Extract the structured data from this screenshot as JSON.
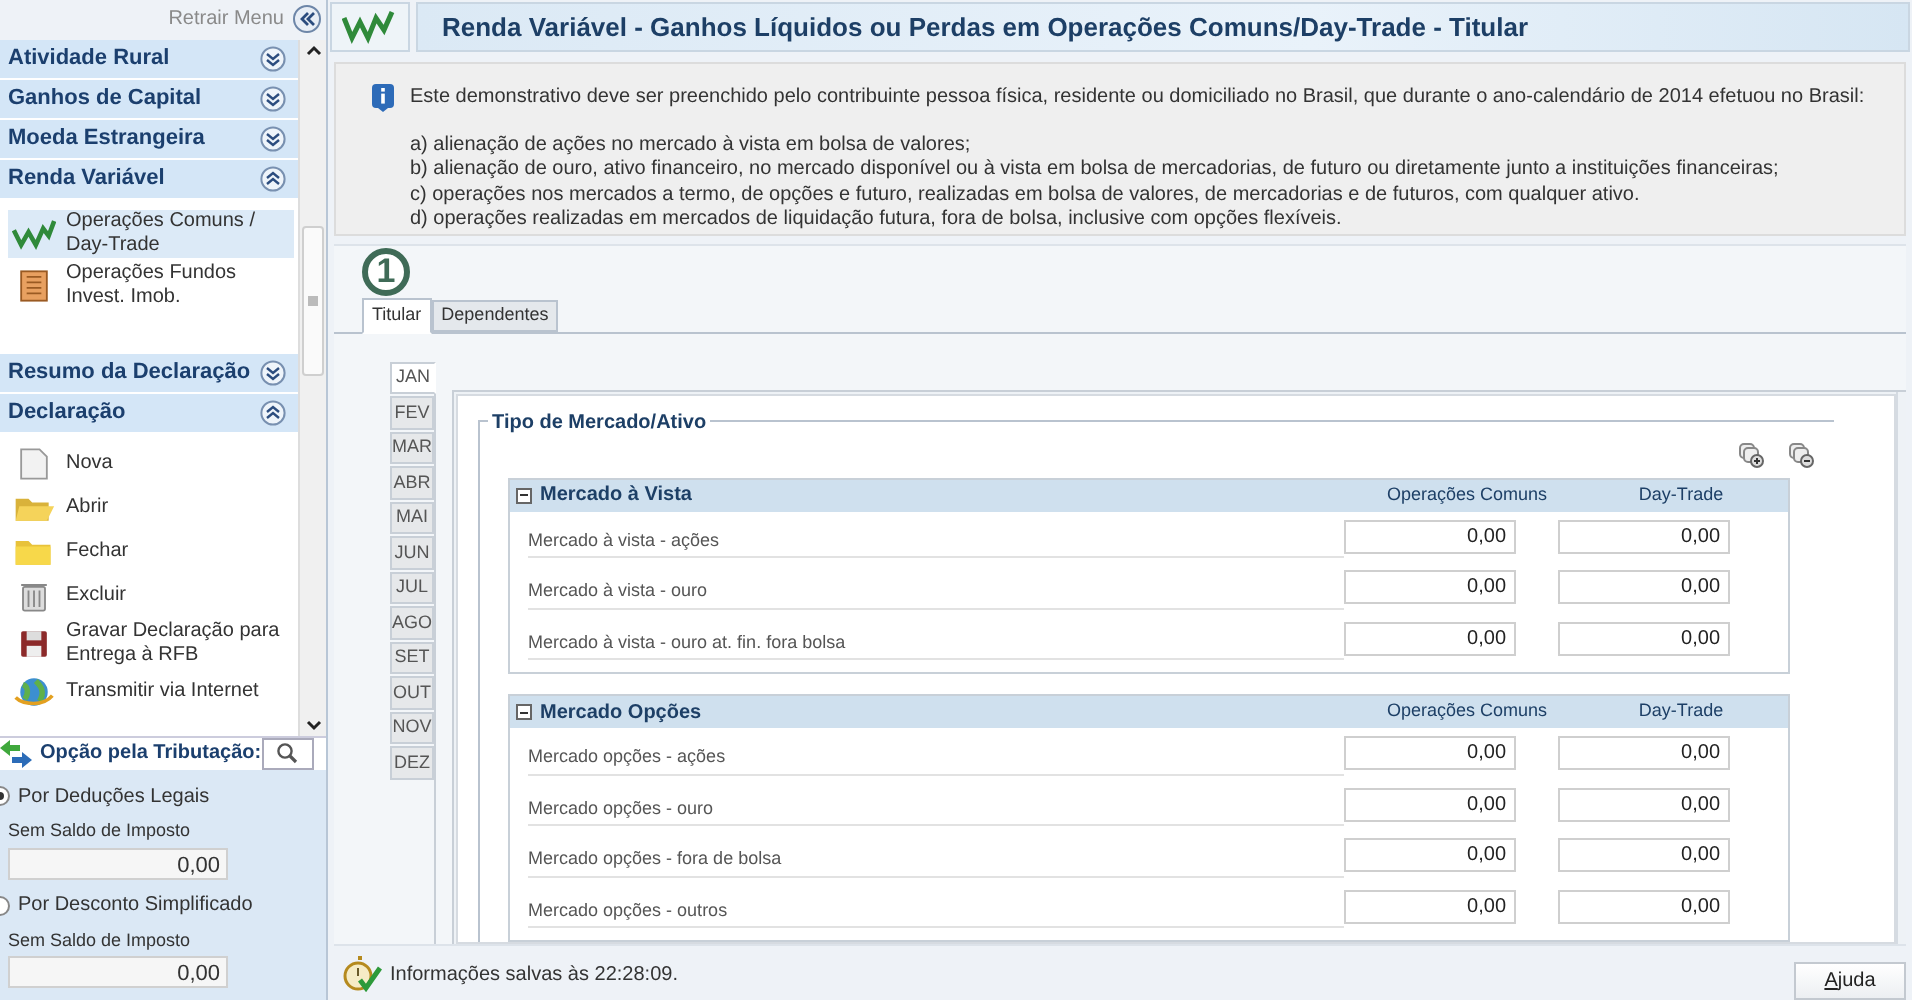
{
  "sidebar": {
    "collapse_label": "Retrair Menu",
    "sections": [
      {
        "title": "Atividade Rural",
        "expanded": false
      },
      {
        "title": "Ganhos de Capital",
        "expanded": false
      },
      {
        "title": "Moeda Estrangeira",
        "expanded": false
      },
      {
        "title": "Renda Variável",
        "expanded": true,
        "items": [
          {
            "label": "Operações Comuns / Day-Trade",
            "selected": true
          },
          {
            "label": "Operações Fundos Invest. Imob.",
            "selected": false
          }
        ]
      },
      {
        "title": "Resumo da Declaração",
        "expanded": false
      },
      {
        "title": "Declaração",
        "expanded": true,
        "items": [
          {
            "label": "Nova",
            "selected": false
          },
          {
            "label": "Abrir",
            "selected": false
          },
          {
            "label": "Fechar",
            "selected": false
          },
          {
            "label": "Excluir",
            "selected": false
          },
          {
            "label": "Gravar Declaração para Entrega à RFB",
            "selected": false
          },
          {
            "label": "Transmitir via Internet",
            "selected": false
          }
        ]
      }
    ]
  },
  "tributacao": {
    "title": "Opção pela Tributação:",
    "options": [
      {
        "label": "Por Deduções Legais",
        "selected": true,
        "caption": "Sem Saldo de Imposto",
        "value": "0,00"
      },
      {
        "label": "Por Desconto Simplificado",
        "selected": false,
        "caption": "Sem Saldo de Imposto",
        "value": "0,00"
      }
    ]
  },
  "page": {
    "title": "Renda Variável - Ganhos Líquidos ou Perdas em Operações Comuns/Day-Trade - Titular",
    "info": {
      "intro": "Este demonstrativo deve ser preenchido pelo contribuinte pessoa física, residente ou domiciliado no Brasil, que durante o ano-calendário de 2014 efetuou no Brasil:",
      "items": [
        "a) alienação de ações no mercado à vista em bolsa de valores;",
        "b) alienação de ouro, ativo financeiro, no mercado disponível ou à vista em bolsa de mercadorias, de futuro ou diretamente junto a instituições financeiras;",
        "c) operações nos mercados a termo, de opções e futuro, realizadas em bolsa de valores, de mercadorias e de futuros, com qualquer ativo.",
        "d) operações realizadas em mercados de liquidação futura, fora de bolsa, inclusive com opções flexíveis."
      ]
    },
    "step_badge": "1",
    "tabs": [
      {
        "label": "Titular",
        "selected": true
      },
      {
        "label": "Dependentes",
        "selected": false
      }
    ],
    "months": [
      {
        "label": "JAN",
        "selected": true
      },
      {
        "label": "FEV",
        "selected": false
      },
      {
        "label": "MAR",
        "selected": false
      },
      {
        "label": "ABR",
        "selected": false
      },
      {
        "label": "MAI",
        "selected": false
      },
      {
        "label": "JUN",
        "selected": false
      },
      {
        "label": "JUL",
        "selected": false
      },
      {
        "label": "AGO",
        "selected": false
      },
      {
        "label": "SET",
        "selected": false
      },
      {
        "label": "OUT",
        "selected": false
      },
      {
        "label": "NOV",
        "selected": false
      },
      {
        "label": "DEZ",
        "selected": false
      }
    ],
    "fieldset_legend": "Tipo de Mercado/Ativo",
    "groups": [
      {
        "title": "Mercado à Vista",
        "expanded": true,
        "columns": [
          "Operações Comuns",
          "Day-Trade"
        ],
        "rows": [
          {
            "label": "Mercado à vista - ações",
            "values": [
              "0,00",
              "0,00"
            ]
          },
          {
            "label": "Mercado à vista - ouro",
            "values": [
              "0,00",
              "0,00"
            ]
          },
          {
            "label": "Mercado à vista - ouro at. fin. fora bolsa",
            "values": [
              "0,00",
              "0,00"
            ]
          }
        ]
      },
      {
        "title": "Mercado Opções",
        "expanded": true,
        "columns": [
          "Operações Comuns",
          "Day-Trade"
        ],
        "rows": [
          {
            "label": "Mercado opções - ações",
            "values": [
              "0,00",
              "0,00"
            ]
          },
          {
            "label": "Mercado opções - ouro",
            "values": [
              "0,00",
              "0,00"
            ]
          },
          {
            "label": "Mercado opções - fora de bolsa",
            "values": [
              "0,00",
              "0,00"
            ]
          },
          {
            "label": "Mercado opções - outros",
            "values": [
              "0,00",
              "0,00"
            ]
          }
        ]
      }
    ],
    "status_message": "Informações salvas às 22:28:09.",
    "help_button": "Ajuda"
  }
}
